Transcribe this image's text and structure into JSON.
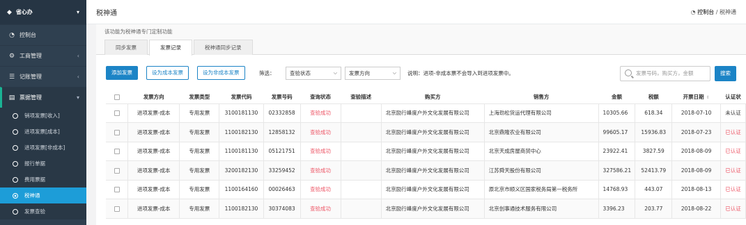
{
  "sidebar": {
    "brand": "省心办",
    "items": [
      {
        "label": "控制台",
        "icon": "dashboard-icon",
        "glyph": "◔"
      },
      {
        "label": "工商管理",
        "icon": "gear-icon",
        "glyph": "⚙"
      },
      {
        "label": "记账管理",
        "icon": "list-icon",
        "glyph": "☰"
      },
      {
        "label": "票据管理",
        "icon": "invoice-icon",
        "glyph": "▤"
      }
    ],
    "subitems": [
      "销项发票[收入]",
      "进项发票[成本]",
      "进项发票[非成本]",
      "报行单据",
      "费用票据",
      "税神通",
      "发票查验"
    ]
  },
  "header": {
    "title": "税神通",
    "breadcrumb_home": "控制台",
    "breadcrumb_sep": "/",
    "breadcrumb_current": "税神通"
  },
  "notice": "该功能为税神通专门定制功能",
  "tabs": [
    "同步发票",
    "发票记录",
    "税神通同步记录"
  ],
  "toolbar": {
    "add_label": "添加发票",
    "set_cost_label": "设为成本发票",
    "set_noncost_label": "设为非成本发票",
    "filter_label": "筛选：",
    "status_select": "查验状态",
    "direction_select": "发票方向",
    "note": "说明：进项-非成本票不会导入到进项发票中。",
    "search_placeholder": "发票号码，购买方，金额",
    "search_button": "搜索"
  },
  "table": {
    "columns": [
      "发票方向",
      "发票类型",
      "发票代码",
      "发票号码",
      "查询状态",
      "查验描述",
      "购买方",
      "销售方",
      "金额",
      "税额",
      "开票日期",
      "认证状"
    ],
    "rows": [
      {
        "direction": "进项发票-成本",
        "type": "专用发票",
        "code": "3100181130",
        "number": "02332858",
        "status": "查验成功",
        "desc": "",
        "buyer": "北京励行峰度户外文化发展有限公司",
        "seller": "上海劲松货运代理有限公司",
        "amount": "10305.66",
        "tax": "618.34",
        "date": "2018-07-10",
        "cert": "未认证"
      },
      {
        "direction": "进项发票-成本",
        "type": "专用发票",
        "code": "1100182130",
        "number": "12858132",
        "status": "查验成功",
        "desc": "",
        "buyer": "北京励行峰度户外文化发展有限公司",
        "seller": "北京鼎隆农业有限公司",
        "amount": "99605.17",
        "tax": "15936.83",
        "date": "2018-07-23",
        "cert": "已认证"
      },
      {
        "direction": "进项发票-成本",
        "type": "专用发票",
        "code": "1100181130",
        "number": "05121751",
        "status": "查验成功",
        "desc": "",
        "buyer": "北京励行峰度户外文化发展有限公司",
        "seller": "北京天成房屋商贸中心",
        "amount": "23922.41",
        "tax": "3827.59",
        "date": "2018-08-09",
        "cert": "已认证"
      },
      {
        "direction": "进项发票-成本",
        "type": "专用发票",
        "code": "3200182130",
        "number": "33259452",
        "status": "查验成功",
        "desc": "",
        "buyer": "北京励行峰度户外文化发展有限公司",
        "seller": "江苏舜天股份有限公司",
        "amount": "327586.21",
        "tax": "52413.79",
        "date": "2018-08-09",
        "cert": "已认证"
      },
      {
        "direction": "进项发票-成本",
        "type": "专用发票",
        "code": "1100164160",
        "number": "00026463",
        "status": "查验成功",
        "desc": "",
        "buyer": "北京励行峰度户外文化发展有限公司",
        "seller": "原北京市顺义区国家税务局第一税务所",
        "amount": "14768.93",
        "tax": "443.07",
        "date": "2018-08-13",
        "cert": "已认证"
      },
      {
        "direction": "进项发票-成本",
        "type": "专用发票",
        "code": "1100182130",
        "number": "30374083",
        "status": "查验成功",
        "desc": "",
        "buyer": "北京励行峰度户外文化发展有限公司",
        "seller": "北京创事通技术服务有限公司",
        "amount": "3396.23",
        "tax": "203.77",
        "date": "2018-08-22",
        "cert": "已认证"
      }
    ]
  },
  "colors": {
    "sidebar": "#2f4050",
    "accent": "#1c84c6",
    "active_sub": "#1d9dd8",
    "error": "#ed5565"
  }
}
